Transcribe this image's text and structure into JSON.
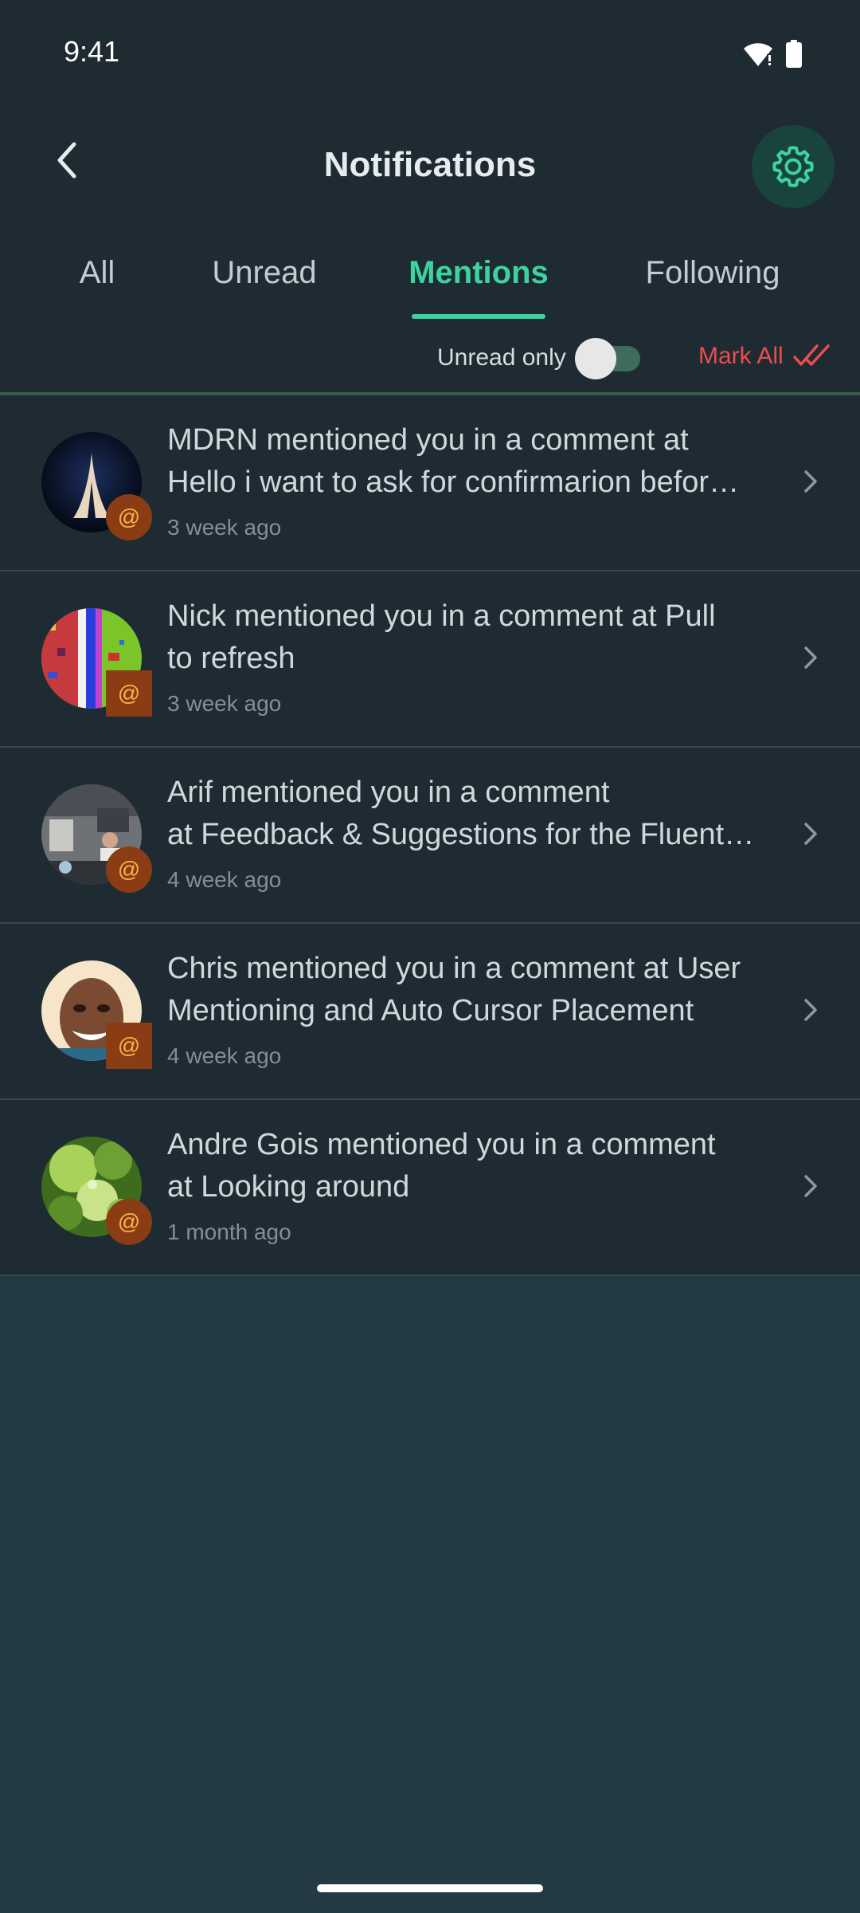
{
  "status_bar": {
    "time": "9:41"
  },
  "header": {
    "title": "Notifications"
  },
  "tabs": [
    {
      "label": "All",
      "active": false
    },
    {
      "label": "Unread",
      "active": false
    },
    {
      "label": "Mentions",
      "active": true
    },
    {
      "label": "Following",
      "active": false
    }
  ],
  "filters": {
    "unread_only_label": "Unread only",
    "unread_only_on": false,
    "mark_all_label": "Mark All"
  },
  "colors": {
    "accent": "#3dd3a1",
    "danger": "#ea4d4d",
    "badge": "#8a3c14",
    "badge_text": "#f6b347",
    "row_bg": "#1f2b32",
    "page_bg": "#233a42"
  },
  "notifications": [
    {
      "line1": "MDRN mentioned you in a comment at",
      "line2": "Hello i want to ask for confirmarion befor…",
      "time": "3 week ago",
      "badge": "@"
    },
    {
      "line1": "Nick mentioned you in a comment at Pull",
      "line2": "to refresh",
      "time": "3 week ago",
      "badge": "@"
    },
    {
      "line1": "Arif mentioned you in a comment",
      "line2": "at Feedback & Suggestions for the Fluent…",
      "time": "4 week ago",
      "badge": "@"
    },
    {
      "line1": "Chris mentioned you in a comment at User",
      "line2": "Mentioning and Auto Cursor Placement",
      "time": "4 week ago",
      "badge": "@"
    },
    {
      "line1": "Andre Gois mentioned you in a comment",
      "line2": "at Looking around",
      "time": "1 month ago",
      "badge": "@"
    }
  ]
}
